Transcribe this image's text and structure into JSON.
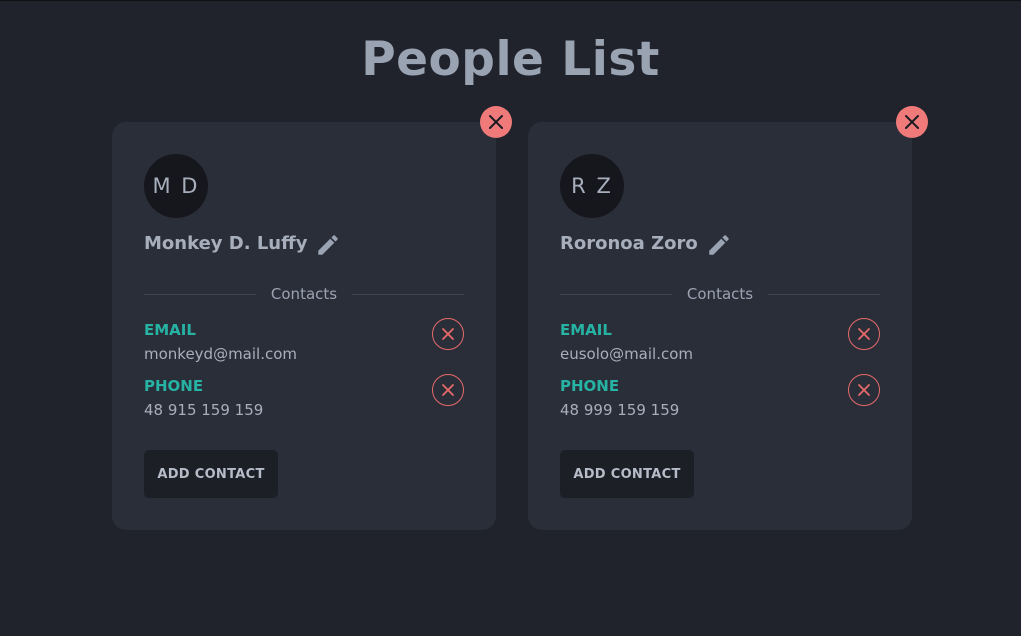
{
  "page": {
    "title": "People List"
  },
  "colors": {
    "background": "#20232b",
    "card": "#2a2e39",
    "accent_teal": "#26b3a4",
    "danger": "#f07a7a"
  },
  "people": [
    {
      "initials": "M D",
      "name": "Monkey D. Luffy",
      "contacts_label": "Contacts",
      "contacts": [
        {
          "type": "EMAIL",
          "value": "monkeyd@mail.com"
        },
        {
          "type": "PHONE",
          "value": "48 915 159 159"
        }
      ],
      "add_contact_label": "ADD CONTACT"
    },
    {
      "initials": "R Z",
      "name": "Roronoa Zoro",
      "contacts_label": "Contacts",
      "contacts": [
        {
          "type": "EMAIL",
          "value": "eusolo@mail.com"
        },
        {
          "type": "PHONE",
          "value": "48 999 159 159"
        }
      ],
      "add_contact_label": "ADD CONTACT"
    }
  ],
  "icons": {
    "delete_person": "close-icon",
    "edit": "pencil-icon",
    "remove_contact": "close-circle-icon"
  }
}
